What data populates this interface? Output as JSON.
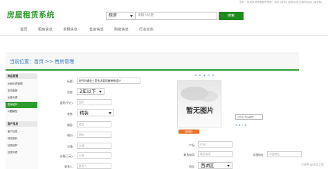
{
  "topbar": {
    "links": "您好，欢迎来到房屋租赁系统 | 退出   [首页] [全部公告] [我的后台] [留言板]"
  },
  "logo": "房屋租赁系统",
  "search": {
    "category": "租房",
    "placeholder": "请输入标题",
    "button": "搜索"
  },
  "nav": [
    "首页",
    "租房信息",
    "求租信息",
    "售房信息",
    "购房信息",
    "行业动态"
  ],
  "breadcrumb": "当前位置：首页 >> 售房管理",
  "sidebar": {
    "group1": "商品管理",
    "items1": [
      "出租列表管理",
      "发布租房",
      "出售列表",
      "售房维护",
      "问题解答"
    ],
    "group2": "客户信息",
    "items2": [
      "客户信息",
      "修改密码",
      "信息维护",
      "信息列表"
    ]
  },
  "toolbar_icons": "⊕⊗◈⊙⊚",
  "form": {
    "title_label": "标题:",
    "title_value": "时代外滩金三室金大厦风格装修设计",
    "age_label": "房龄:",
    "age_value": "2年以下",
    "area_label": "面积(平方):",
    "area_placeholder": "面积",
    "decor_label": "装修:",
    "decor_value": "精装",
    "floor_label": "楼层:",
    "floor_placeholder": "楼层",
    "orient_label": "朝向:",
    "orient_placeholder": "朝向",
    "transport_label": "交通:",
    "transport_placeholder": "交通",
    "price_label": "价格(万元):",
    "price_placeholder": "价格",
    "contact_label": "联系人:",
    "contact_placeholder": "联系人",
    "property_label": "产权:",
    "property_placeholder": "产业",
    "phone_label": "联系电话:",
    "phone_placeholder": "联系电话",
    "address_label": "详细地址:",
    "address_placeholder": "详细地址",
    "district_label": "地区:",
    "district_value": "西湖区"
  },
  "image": {
    "placeholder_text": "暂无图片",
    "upload_button": "选择图片",
    "tooltip": "只允许上传jpg格式"
  },
  "watermark": "CSDN @毕设之家"
}
